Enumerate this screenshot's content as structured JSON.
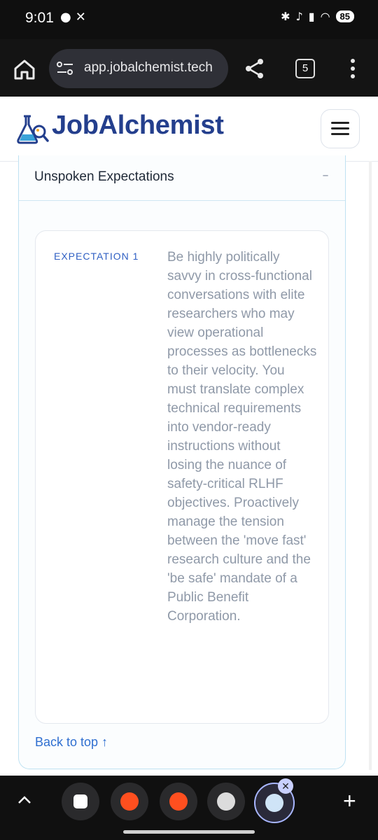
{
  "status_bar": {
    "time": "9:01",
    "battery": "85"
  },
  "browser": {
    "url": "app.jobalchemist.tech",
    "tab_count": "5"
  },
  "site": {
    "brand": "JobAlchemist"
  },
  "section": {
    "title": "Unspoken Expectations",
    "toggle": "–",
    "expectation_label": "EXPECTATION 1",
    "expectation_text": "Be highly politically savvy in cross-functional conversations with elite researchers who may view operational processes as bottlenecks to their velocity. You must translate complex technical requirements into vendor-ready instructions without losing the nuance of safety-critical RLHF objectives. Proactively manage the tension between the 'move fast' research culture and the 'be safe' mandate of a Public Benefit Corporation.",
    "back_to_top": "Back to top ↑"
  },
  "dock": {
    "close": "✕",
    "plus": "+"
  },
  "colors": {
    "brand": "#243f8d",
    "label_blue": "#2f5fc3",
    "link_blue": "#2f6fd0",
    "muted_text": "#8f99a8"
  }
}
